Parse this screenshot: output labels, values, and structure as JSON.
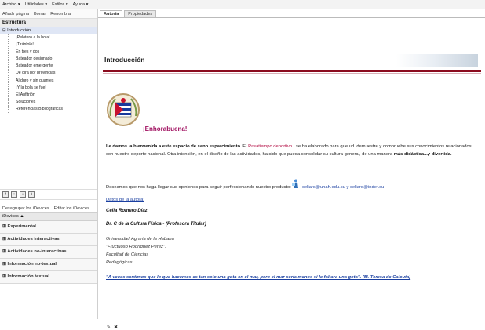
{
  "menubar": [
    "Archivo ▾",
    "Utilidades ▾",
    "Estilos ▾",
    "Ayuda ▾"
  ],
  "outline_toolbar": [
    "Añadir página",
    "Borrar",
    "Renombrar"
  ],
  "structure_header": "Estructura",
  "tree": {
    "root": "Introducción",
    "children": [
      "¡Pelotero a la bola!",
      "¡Tiránlole!",
      "En tres y dos",
      "Bateador designado",
      "Bateador emergente",
      "De gira por provincias",
      "Al duro y sin guantes",
      "¡Y la bola se fue!",
      "El Anfitrión",
      "Soluciones",
      "Referencias Bibliográficas"
    ]
  },
  "idevice_buttons": [
    "Desagrupar los iDevices",
    "Editar los iDevices"
  ],
  "devices_header": "iDevices ▲",
  "categories": [
    "Experimental",
    "Actividades interactivas",
    "Actividades no-interactivas",
    "Información no-textual",
    "Información textual"
  ],
  "tabs": [
    "Autoría",
    "Propiedades"
  ],
  "page_title": "Introducción",
  "greeting": "¡Enhorabuena!",
  "intro": {
    "bold_start": "Le damos la bienvenida a este espacio de sano esparcimiento.",
    "mid1": " El ",
    "red": "Pasatiempo deportivo I",
    "mid2": " se ha elaborado para que ud. demuestre y compruebe sus conocimientos relacionados con nuestro deporte nacional. Otra intención, en el diseño de las actividades, ha sido que pueda consolidar su cultura general, de una manera ",
    "bold_end": "más didáctica...y divertida."
  },
  "invite_text": "Deseamos que nos haga llegar sus opiniones para seguir perfeccionando nuestro producto:",
  "emails": "celiard@unah.edu.cu y celiard@inder.cu",
  "author_link": "Datos de la autora:",
  "author_name": "Celia Romero Díaz",
  "author_degree": "Dr. C de la Cultura Física - (Profesora Titular)",
  "institution": [
    "Universidad Agraria de la Habana",
    "\"Fructuoso Rodríguez Pérez\".",
    "Facultad de Ciencias",
    "Pedagógicas."
  ],
  "quote": "\"A veces sentimos que lo que hacemos es tan solo una gota en el mar, pero el mar sería menos si le faltara una gota\". (M. Teresa de Calcuta)",
  "colors": {
    "accent_line": "#8b0b1e",
    "greeting": "#a01060",
    "link": "#1a3fa0"
  }
}
